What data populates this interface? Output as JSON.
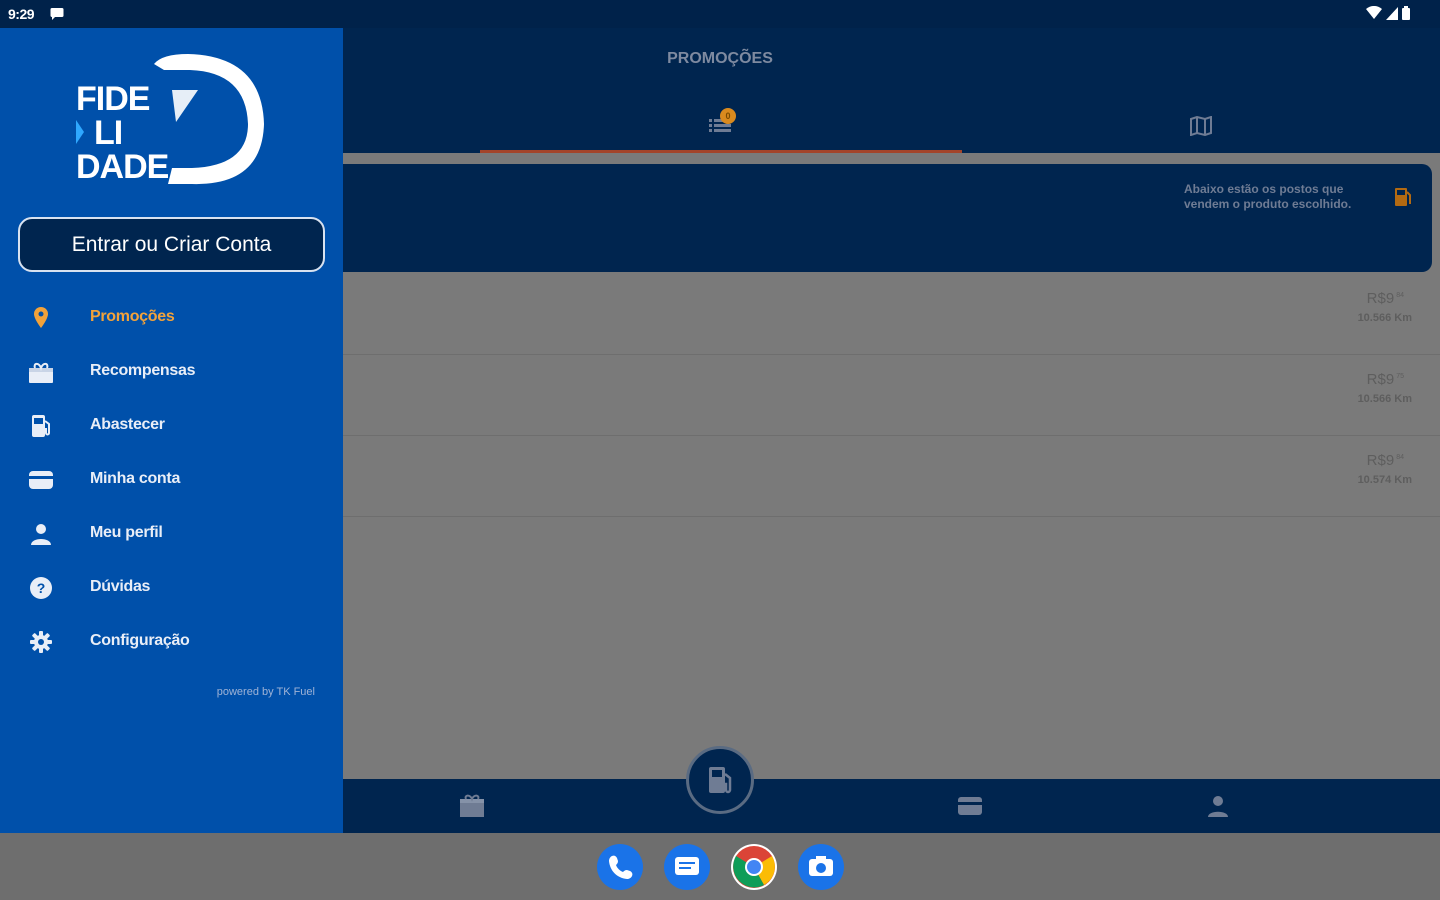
{
  "status_bar": {
    "time": "9:29"
  },
  "app": {
    "title": "PROMOÇÕES",
    "tabs": [
      {
        "icon": "list-icon",
        "badge": "0",
        "selected": true
      },
      {
        "icon": "map-icon",
        "selected": false
      }
    ],
    "info_text": "Abaixo estão os postos que vendem o produto escolhido.",
    "stations": [
      {
        "price": "R$9",
        "price_decimal": "84",
        "distance": "10.566 Km"
      },
      {
        "price": "R$9",
        "price_decimal": "75",
        "distance": "10.566 Km"
      },
      {
        "price": "R$9",
        "price_decimal": "84",
        "distance": "10.574 Km"
      }
    ]
  },
  "drawer": {
    "logo_lines": [
      "FIDE",
      "LI",
      "DADE"
    ],
    "login_button": "Entrar ou Criar Conta",
    "menu": [
      {
        "label": "Promoções",
        "icon": "location-pin-icon",
        "active": true
      },
      {
        "label": "Recompensas",
        "icon": "gift-icon",
        "active": false
      },
      {
        "label": "Abastecer",
        "icon": "fuel-pump-icon",
        "active": false
      },
      {
        "label": "Minha conta",
        "icon": "card-icon",
        "active": false
      },
      {
        "label": "Meu perfil",
        "icon": "person-icon",
        "active": false
      },
      {
        "label": "Dúvidas",
        "icon": "help-icon",
        "active": false
      },
      {
        "label": "Configuração",
        "icon": "gear-icon",
        "active": false
      }
    ],
    "powered_by": "powered by TK Fuel"
  },
  "colors": {
    "drawer_bg": "#0050aa",
    "header_bg": "#00254f",
    "active": "#f2a23a"
  }
}
